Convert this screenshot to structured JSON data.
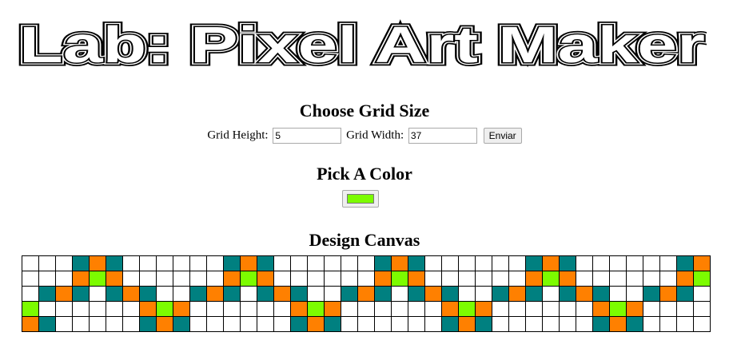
{
  "app": {
    "title": "Lab: Pixel Art Maker"
  },
  "size_section": {
    "heading": "Choose Grid Size",
    "height_label": "Grid Height:",
    "height_value": "5",
    "width_label": "Grid Width:",
    "width_value": "37",
    "submit_label": "Enviar"
  },
  "color_section": {
    "heading": "Pick A Color",
    "selected_color": "#7cfc00"
  },
  "canvas_section": {
    "heading": "Design Canvas",
    "palette": {
      "W": "#ffffff",
      "T": "#008080",
      "O": "#ff8000",
      "G": "#7cfc00"
    },
    "rows": [
      "WWWTOTWWWWWWTOTWWWWWWTOTWWWWWWTOTWWWWWWTO",
      "WWWOGOWWWWWWOGOWWWWWWOGOWWWWWWOGOWWWWWWOG",
      "WTOTWTOTWWTOTWTOTWWTOTWTOTWWTOTWTOTWWTOTW",
      "GWWWWWWOGOWWWWWWOGOWWWWWWOGOWWWWWWOGOWWWW",
      "OTWWWWWTOTWWWWWWTOTWWWWWWTOTWWWWWWTOTWWWW"
    ]
  }
}
